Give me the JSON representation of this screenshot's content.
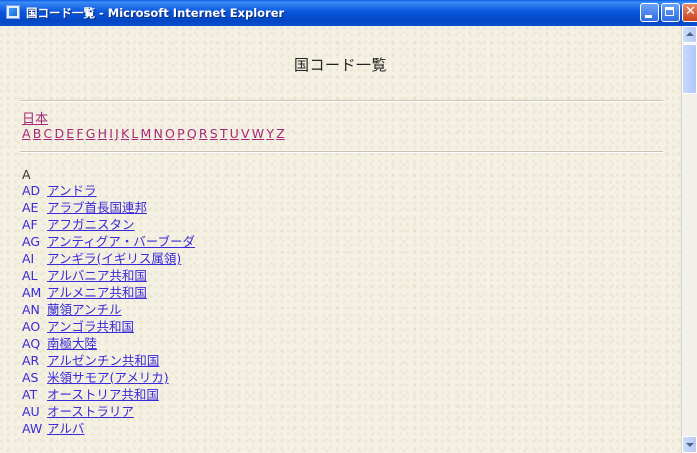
{
  "window": {
    "title": "国コード一覧 - Microsoft Internet Explorer"
  },
  "page": {
    "heading": "国コード一覧",
    "japan_link": "日本",
    "alphabet": [
      "A",
      "B",
      "C",
      "D",
      "E",
      "F",
      "G",
      "H",
      "I",
      "J",
      "K",
      "L",
      "M",
      "N",
      "O",
      "P",
      "Q",
      "R",
      "S",
      "T",
      "U",
      "V",
      "W",
      "Y",
      "Z"
    ],
    "section_letter": "A",
    "countries": [
      {
        "code": "AD",
        "name": "アンドラ"
      },
      {
        "code": "AE",
        "name": "アラブ首長国連邦"
      },
      {
        "code": "AF",
        "name": "アフガニスタン"
      },
      {
        "code": "AG",
        "name": "アンティグア・バーブーダ"
      },
      {
        "code": "AI",
        "name": "アンギラ(イギリス属領)"
      },
      {
        "code": "AL",
        "name": "アルバニア共和国"
      },
      {
        "code": "AM",
        "name": "アルメニア共和国"
      },
      {
        "code": "AN",
        "name": "蘭領アンチル"
      },
      {
        "code": "AO",
        "name": "アンゴラ共和国"
      },
      {
        "code": "AQ",
        "name": "南極大陸"
      },
      {
        "code": "AR",
        "name": "アルゼンチン共和国"
      },
      {
        "code": "AS",
        "name": "米領サモア(アメリカ)"
      },
      {
        "code": "AT",
        "name": "オーストリア共和国"
      },
      {
        "code": "AU",
        "name": "オーストラリア"
      },
      {
        "code": "AW",
        "name": "アルバ"
      }
    ]
  },
  "colors": {
    "link": "#3a2ad8",
    "visited_link": "#a5297a",
    "titlebar": "#0a55dd",
    "background": "#f4f0e2"
  }
}
